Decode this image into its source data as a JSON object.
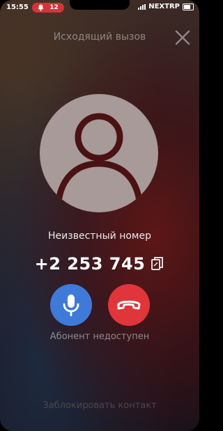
{
  "status_bar": {
    "time": "15:55",
    "notification_count": "12",
    "carrier": "NEXTRP"
  },
  "header": {
    "title": "Исходящий вызов"
  },
  "caller": {
    "label": "Неизвестный номер",
    "number": "+2 253 745"
  },
  "call": {
    "status": "Абонент недоступен"
  },
  "footer": {
    "block_label": "Заблокировать контакт"
  },
  "icons": {
    "close": "close-icon",
    "avatar": "person-avatar-icon",
    "copy": "copy-icon",
    "mic": "microphone-icon",
    "hangup": "phone-hangup-icon",
    "bell": "bell-icon",
    "signal": "signal-icon",
    "battery": "battery-icon"
  },
  "colors": {
    "mic_button": "#3f7ad8",
    "hangup_button": "#e0353b",
    "notification_pill": "#d6333a"
  }
}
